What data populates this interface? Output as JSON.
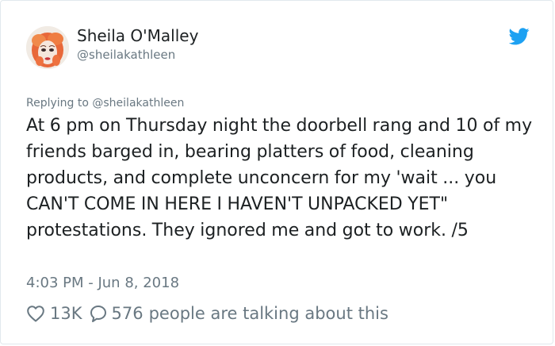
{
  "author": {
    "name": "Sheila O'Malley",
    "handle": "@sheilakathleen",
    "avatar_icon": "avatar-portrait"
  },
  "brand": {
    "icon": "twitter-bird-icon",
    "color": "#1da1f2"
  },
  "reply": {
    "prefix": "Replying to ",
    "mention": "@sheilakathleen"
  },
  "tweet": {
    "text": "At 6 pm on Thursday night the doorbell rang and 10 of my friends barged in, bearing platters of food, cleaning products, and complete unconcern for my 'wait ... you CAN'T COME IN HERE I HAVEN'T UNPACKED YET\" protestations. They ignored me and got to work. /5",
    "timestamp": "4:03 PM - Jun 8, 2018"
  },
  "stats": {
    "likes": "13K",
    "replies": "576",
    "talking_label": "people are talking about this"
  },
  "colors": {
    "text": "#1c2022",
    "secondary": "#697882",
    "border": "#e1e8ed"
  }
}
